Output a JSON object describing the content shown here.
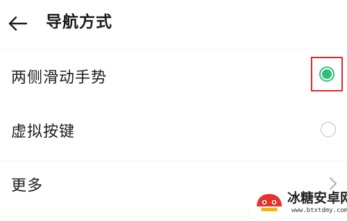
{
  "header": {
    "title": "导航方式",
    "back_icon": "arrow-left-icon"
  },
  "options": [
    {
      "label": "两侧滑动手势",
      "selected": true
    },
    {
      "label": "虚拟按键",
      "selected": false
    }
  ],
  "more": {
    "label": "更多",
    "icon": "chevron-right-icon"
  },
  "watermark": {
    "title": "冰糖安卓网",
    "url": "www.btxtdmy.com"
  },
  "colors": {
    "accent": "#2fbf7a",
    "highlight_box": "#e0262b",
    "text": "#1c1c1c"
  }
}
